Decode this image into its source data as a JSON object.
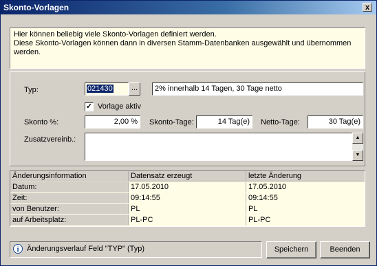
{
  "window": {
    "title": "Skonto-Vorlagen",
    "close_label": "x"
  },
  "info": {
    "line1": "Hier können beliebig viele Skonto-Vorlagen definiert werden.",
    "line2": "Diese Skonto-Vorlagen können dann in diversen Stamm-Datenbanken ausgewählt und übernommen werden."
  },
  "form": {
    "typ_label": "Typ:",
    "typ_value": "021430",
    "browse_label": "...",
    "description_value": "2% innerhalb 14 Tagen, 30 Tage netto",
    "active_label": "Vorlage aktiv",
    "active_checked": true,
    "skonto_pct_label": "Skonto %:",
    "skonto_pct_value": "2,00 %",
    "skonto_tage_label": "Skonto-Tage:",
    "skonto_tage_value": "14 Tag(e)",
    "netto_tage_label": "Netto-Tage:",
    "netto_tage_value": "30 Tag(e)",
    "zusatz_label": "Zusatzvereinb.:",
    "zusatz_value": ""
  },
  "changes": {
    "headers": [
      "Änderungsinformation",
      "Datensatz erzeugt",
      "letzte Änderung"
    ],
    "rows": [
      {
        "label": "Datum:",
        "created": "17.05.2010",
        "modified": "17.05.2010"
      },
      {
        "label": "Zeit:",
        "created": "09:14:55",
        "modified": "09:14:55"
      },
      {
        "label": "von Benutzer:",
        "created": "PL",
        "modified": "PL"
      },
      {
        "label": "auf Arbeitsplatz:",
        "created": "PL-PC",
        "modified": "PL-PC"
      }
    ]
  },
  "status": {
    "icon": "info-icon",
    "text": "Änderungsverlauf Feld \"TYP\" (Typ)"
  },
  "buttons": {
    "save": "Speichern",
    "exit": "Beenden"
  },
  "colors": {
    "titlebar": "#0a246a",
    "panel": "#d4d0c8",
    "highlight_field": "#fffde6"
  }
}
